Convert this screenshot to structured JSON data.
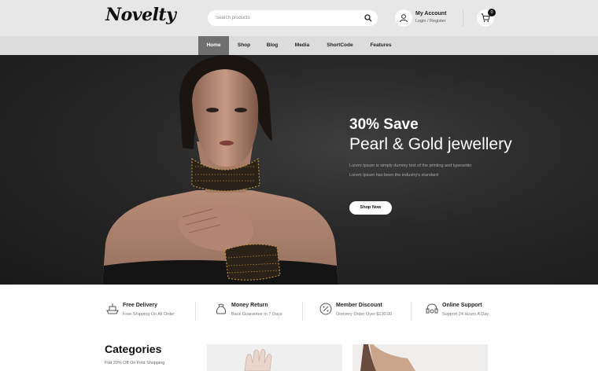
{
  "header": {
    "logo": "Novelty",
    "search": {
      "placeholder": "Search products"
    },
    "account": {
      "title": "My Account",
      "links": "Login / Register"
    },
    "cart": {
      "count": "0"
    }
  },
  "nav": {
    "items": [
      {
        "label": "Home",
        "active": true
      },
      {
        "label": "Shop"
      },
      {
        "label": "Blog"
      },
      {
        "label": "Media"
      },
      {
        "label": "ShortCode"
      },
      {
        "label": "Features"
      }
    ]
  },
  "hero": {
    "save": "30% Save",
    "title": "Pearl & Gold jewellery",
    "desc_line1": "Lorem Ipsum is simply dummy text of the printing and typesettin",
    "desc_line2": "Lorem Ipsum has been the industry's standard",
    "button": "Shop Now"
  },
  "features": [
    {
      "title": "Free Delivery",
      "sub": "Free Shipping On All Order",
      "icon": "ship-icon"
    },
    {
      "title": "Money Return",
      "sub": "Back Guarantee In 7 Days",
      "icon": "money-bag-icon"
    },
    {
      "title": "Member Discount",
      "sub": "Onevery Order Over $130.00",
      "icon": "discount-icon"
    },
    {
      "title": "Online Support",
      "sub": "Support 24 Hours A Day",
      "icon": "headset-icon"
    }
  ],
  "categories": {
    "title": "Categories",
    "sub": "Flat 20% Off On First Shopping"
  },
  "colors": {
    "header_bg": "#e7e7e7",
    "nav_bg": "#dcdcdc",
    "nav_active": "#6f6f6f",
    "hero_bg": "#272727"
  }
}
